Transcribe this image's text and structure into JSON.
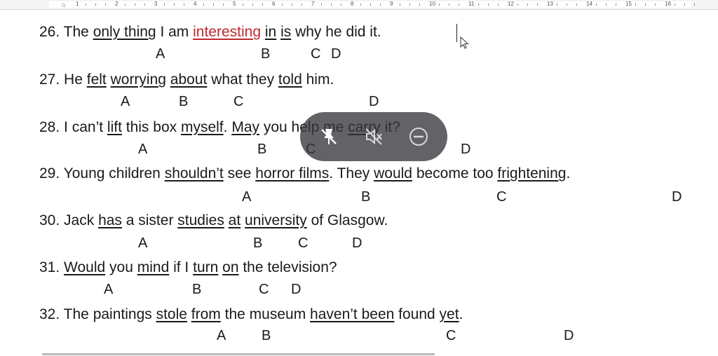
{
  "ruler": {
    "numbers": [
      "1",
      "2",
      "3",
      "4",
      "5",
      "6",
      "7",
      "8",
      "9",
      "10",
      "11",
      "12",
      "13",
      "14",
      "15",
      "16"
    ]
  },
  "questions": [
    {
      "number": "26.",
      "parts": [
        {
          "text": "The "
        },
        {
          "text": "only thing",
          "u": true
        },
        {
          "text": " I am "
        },
        {
          "text": "interesting",
          "u": true,
          "red": true
        },
        {
          "text": " "
        },
        {
          "text": "in",
          "u": true
        },
        {
          "text": " "
        },
        {
          "text": "is",
          "u": true
        },
        {
          "text": " why he did it."
        }
      ],
      "labels": [
        "A",
        "B",
        "C",
        "D"
      ]
    },
    {
      "number": "27.",
      "parts": [
        {
          "text": "He "
        },
        {
          "text": "felt",
          "u": true
        },
        {
          "text": " "
        },
        {
          "text": "worrying",
          "u": true
        },
        {
          "text": " "
        },
        {
          "text": "about",
          "u": true
        },
        {
          "text": " what they "
        },
        {
          "text": "told",
          "u": true
        },
        {
          "text": " him."
        }
      ],
      "labels": [
        "A",
        "B",
        "C",
        "D"
      ]
    },
    {
      "number": "28.",
      "parts": [
        {
          "text": "I can’t "
        },
        {
          "text": "lift",
          "u": true
        },
        {
          "text": " this box "
        },
        {
          "text": "myself",
          "u": true
        },
        {
          "text": ". "
        },
        {
          "text": "May",
          "u": true
        },
        {
          "text": " you help me "
        },
        {
          "text": "carry",
          "u": true
        },
        {
          "text": " it?"
        }
      ],
      "labels": [
        "A",
        "B",
        "C",
        "D"
      ]
    },
    {
      "number": "29.",
      "parts": [
        {
          "text": "Young children "
        },
        {
          "text": "shouldn’t",
          "u": true
        },
        {
          "text": " see "
        },
        {
          "text": "horror films",
          "u": true
        },
        {
          "text": ". They "
        },
        {
          "text": "would",
          "u": true
        },
        {
          "text": " become too "
        },
        {
          "text": "frightening",
          "u": true
        },
        {
          "text": "."
        }
      ],
      "labels": [
        "A",
        "B",
        "C",
        "D"
      ]
    },
    {
      "number": "30.",
      "parts": [
        {
          "text": "Jack "
        },
        {
          "text": "has",
          "u": true
        },
        {
          "text": " a sister "
        },
        {
          "text": "studies",
          "u": true
        },
        {
          "text": " "
        },
        {
          "text": "at",
          "u": true
        },
        {
          "text": " "
        },
        {
          "text": "university",
          "u": true
        },
        {
          "text": " of Glasgow."
        }
      ],
      "labels": [
        "A",
        "B",
        "C",
        "D"
      ]
    },
    {
      "number": "31.",
      "parts": [
        {
          "text": "Would",
          "u": true
        },
        {
          "text": " you "
        },
        {
          "text": "mind",
          "u": true
        },
        {
          "text": " if I "
        },
        {
          "text": "turn",
          "u": true
        },
        {
          "text": " "
        },
        {
          "text": "on",
          "u": true
        },
        {
          "text": " the television?"
        }
      ],
      "labels": [
        "A",
        "B",
        "C",
        "D"
      ]
    },
    {
      "number": "32.",
      "parts": [
        {
          "text": "The paintings "
        },
        {
          "text": "stole",
          "u": true
        },
        {
          "text": " "
        },
        {
          "text": "from",
          "u": true
        },
        {
          "text": " the museum "
        },
        {
          "text": "haven’t been",
          "u": true
        },
        {
          "text": " found "
        },
        {
          "text": "yet",
          "u": true
        },
        {
          "text": "."
        }
      ],
      "labels": [
        "A",
        "B",
        "C",
        "D"
      ]
    }
  ],
  "overlay": {
    "icons": [
      "pin-off-icon",
      "mute-icon",
      "minus-circle-icon"
    ]
  },
  "colors": {
    "highlight_red": "#c0282d",
    "overlay_bg": "#37373c"
  }
}
